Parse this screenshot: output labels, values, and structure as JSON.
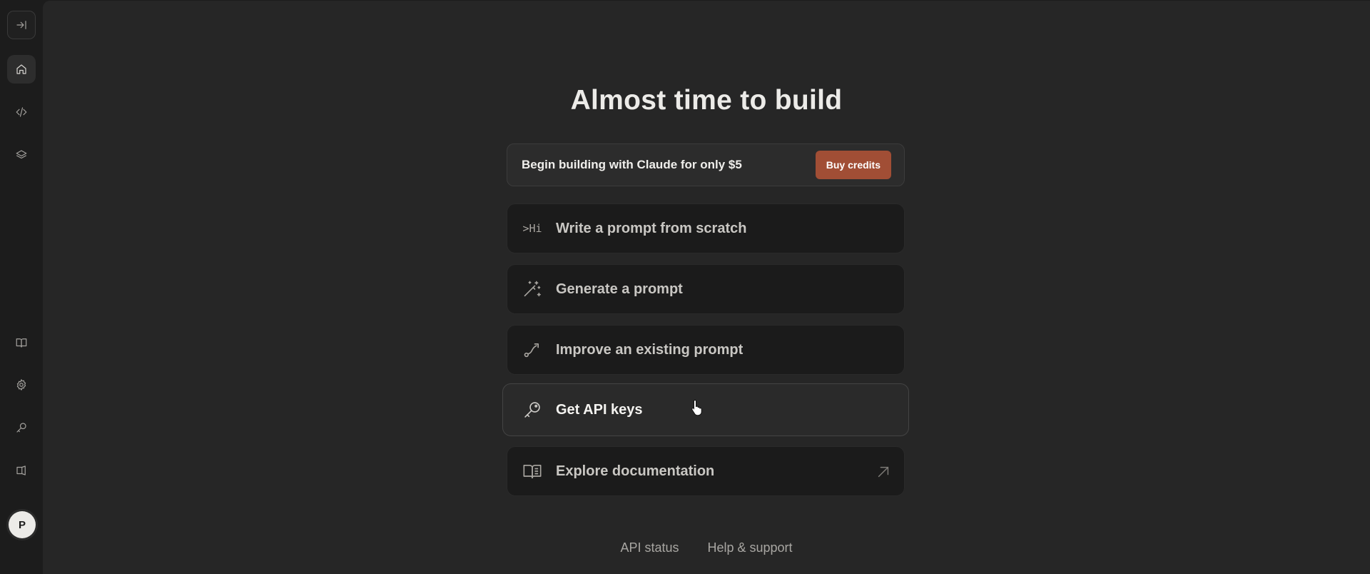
{
  "sidebar": {
    "top": [
      {
        "name": "collapse-sidebar-icon"
      },
      {
        "name": "home-icon",
        "active": true
      },
      {
        "name": "code-icon"
      },
      {
        "name": "layers-icon"
      }
    ],
    "bottom": [
      {
        "name": "book-icon"
      },
      {
        "name": "gear-icon"
      },
      {
        "name": "key-icon"
      },
      {
        "name": "megaphone-icon"
      }
    ],
    "avatar_initial": "P"
  },
  "main": {
    "title": "Almost time to build",
    "credit_banner": {
      "text": "Begin building with Claude for only $5",
      "button": "Buy credits"
    },
    "actions": [
      {
        "icon": "prompt-hi-icon",
        "icon_text": ">Hi",
        "label": "Write a prompt from scratch"
      },
      {
        "icon": "magic-wand-icon",
        "label": "Generate a prompt"
      },
      {
        "icon": "route-icon",
        "label": "Improve an existing prompt"
      },
      {
        "icon": "key-icon",
        "label": "Get API keys"
      },
      {
        "icon": "book-open-icon",
        "label": "Explore documentation",
        "external": "arrow-up-right-icon"
      }
    ],
    "footer": {
      "api_status": "API status",
      "help": "Help & support"
    }
  },
  "colors": {
    "accent": "#a14e35",
    "background": "#262626",
    "sidebar": "#1c1c1c"
  }
}
